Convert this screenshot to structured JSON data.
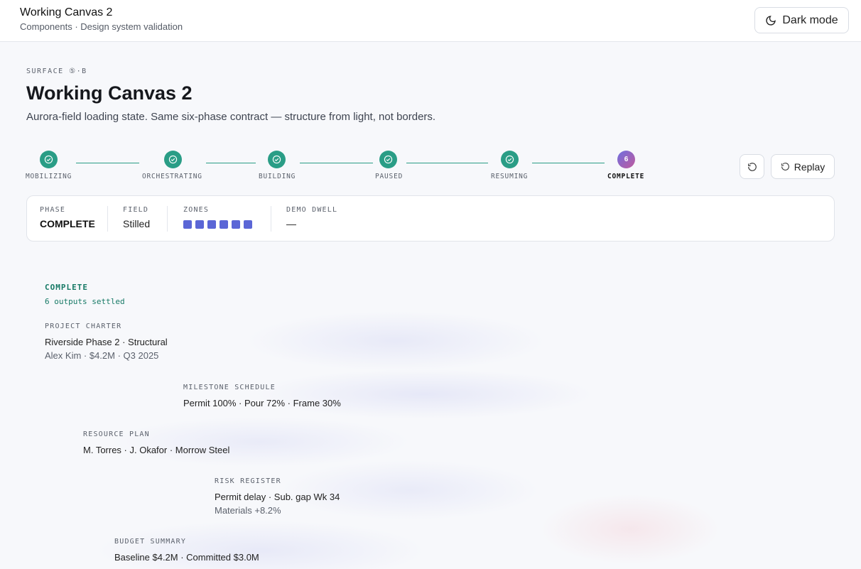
{
  "header": {
    "title": "Working Canvas 2",
    "subtitle": "Components · Design system validation",
    "dark_mode_label": "Dark mode"
  },
  "surface": {
    "eyebrow": "SURFACE ⑤·B",
    "title": "Working Canvas 2",
    "description": "Aurora-field loading state. Same six-phase contract — structure from light, not borders."
  },
  "stepper": {
    "steps": [
      {
        "label": "MOBILIZING",
        "state": "done"
      },
      {
        "label": "ORCHESTRATING",
        "state": "done"
      },
      {
        "label": "BUILDING",
        "state": "done"
      },
      {
        "label": "PAUSED",
        "state": "done"
      },
      {
        "label": "RESUMING",
        "state": "done"
      },
      {
        "label": "COMPLETE",
        "state": "current",
        "number": "6"
      }
    ],
    "replay_label": "Replay"
  },
  "status": {
    "phase_key": "PHASE",
    "phase_value": "COMPLETE",
    "field_key": "FIELD",
    "field_value": "Stilled",
    "zones_key": "ZONES",
    "zones_count": 6,
    "zone_color": "#5b66d6",
    "dwell_key": "DEMO DWELL",
    "dwell_value": "—"
  },
  "canvas": {
    "status_label": "COMPLETE",
    "status_sub": "6 outputs settled",
    "outputs": [
      {
        "heading": "PROJECT CHARTER",
        "line1": "Riverside Phase 2 · Structural",
        "line2": "Alex Kim · $4.2M · Q3 2025"
      },
      {
        "heading": "MILESTONE SCHEDULE",
        "line1": "Permit 100% · Pour 72% · Frame 30%"
      },
      {
        "heading": "RESOURCE PLAN",
        "line1": "M. Torres · J. Okafor · Morrow Steel"
      },
      {
        "heading": "RISK REGISTER",
        "line1": "Permit delay · Sub. gap Wk 34",
        "line2": "Materials +8.2%"
      },
      {
        "heading": "BUDGET SUMMARY",
        "line1": "Baseline $4.2M · Committed $3.0M"
      }
    ]
  },
  "colors": {
    "accent": "#2a9d86",
    "complete_text": "#177a66",
    "zone": "#5b66d6"
  }
}
